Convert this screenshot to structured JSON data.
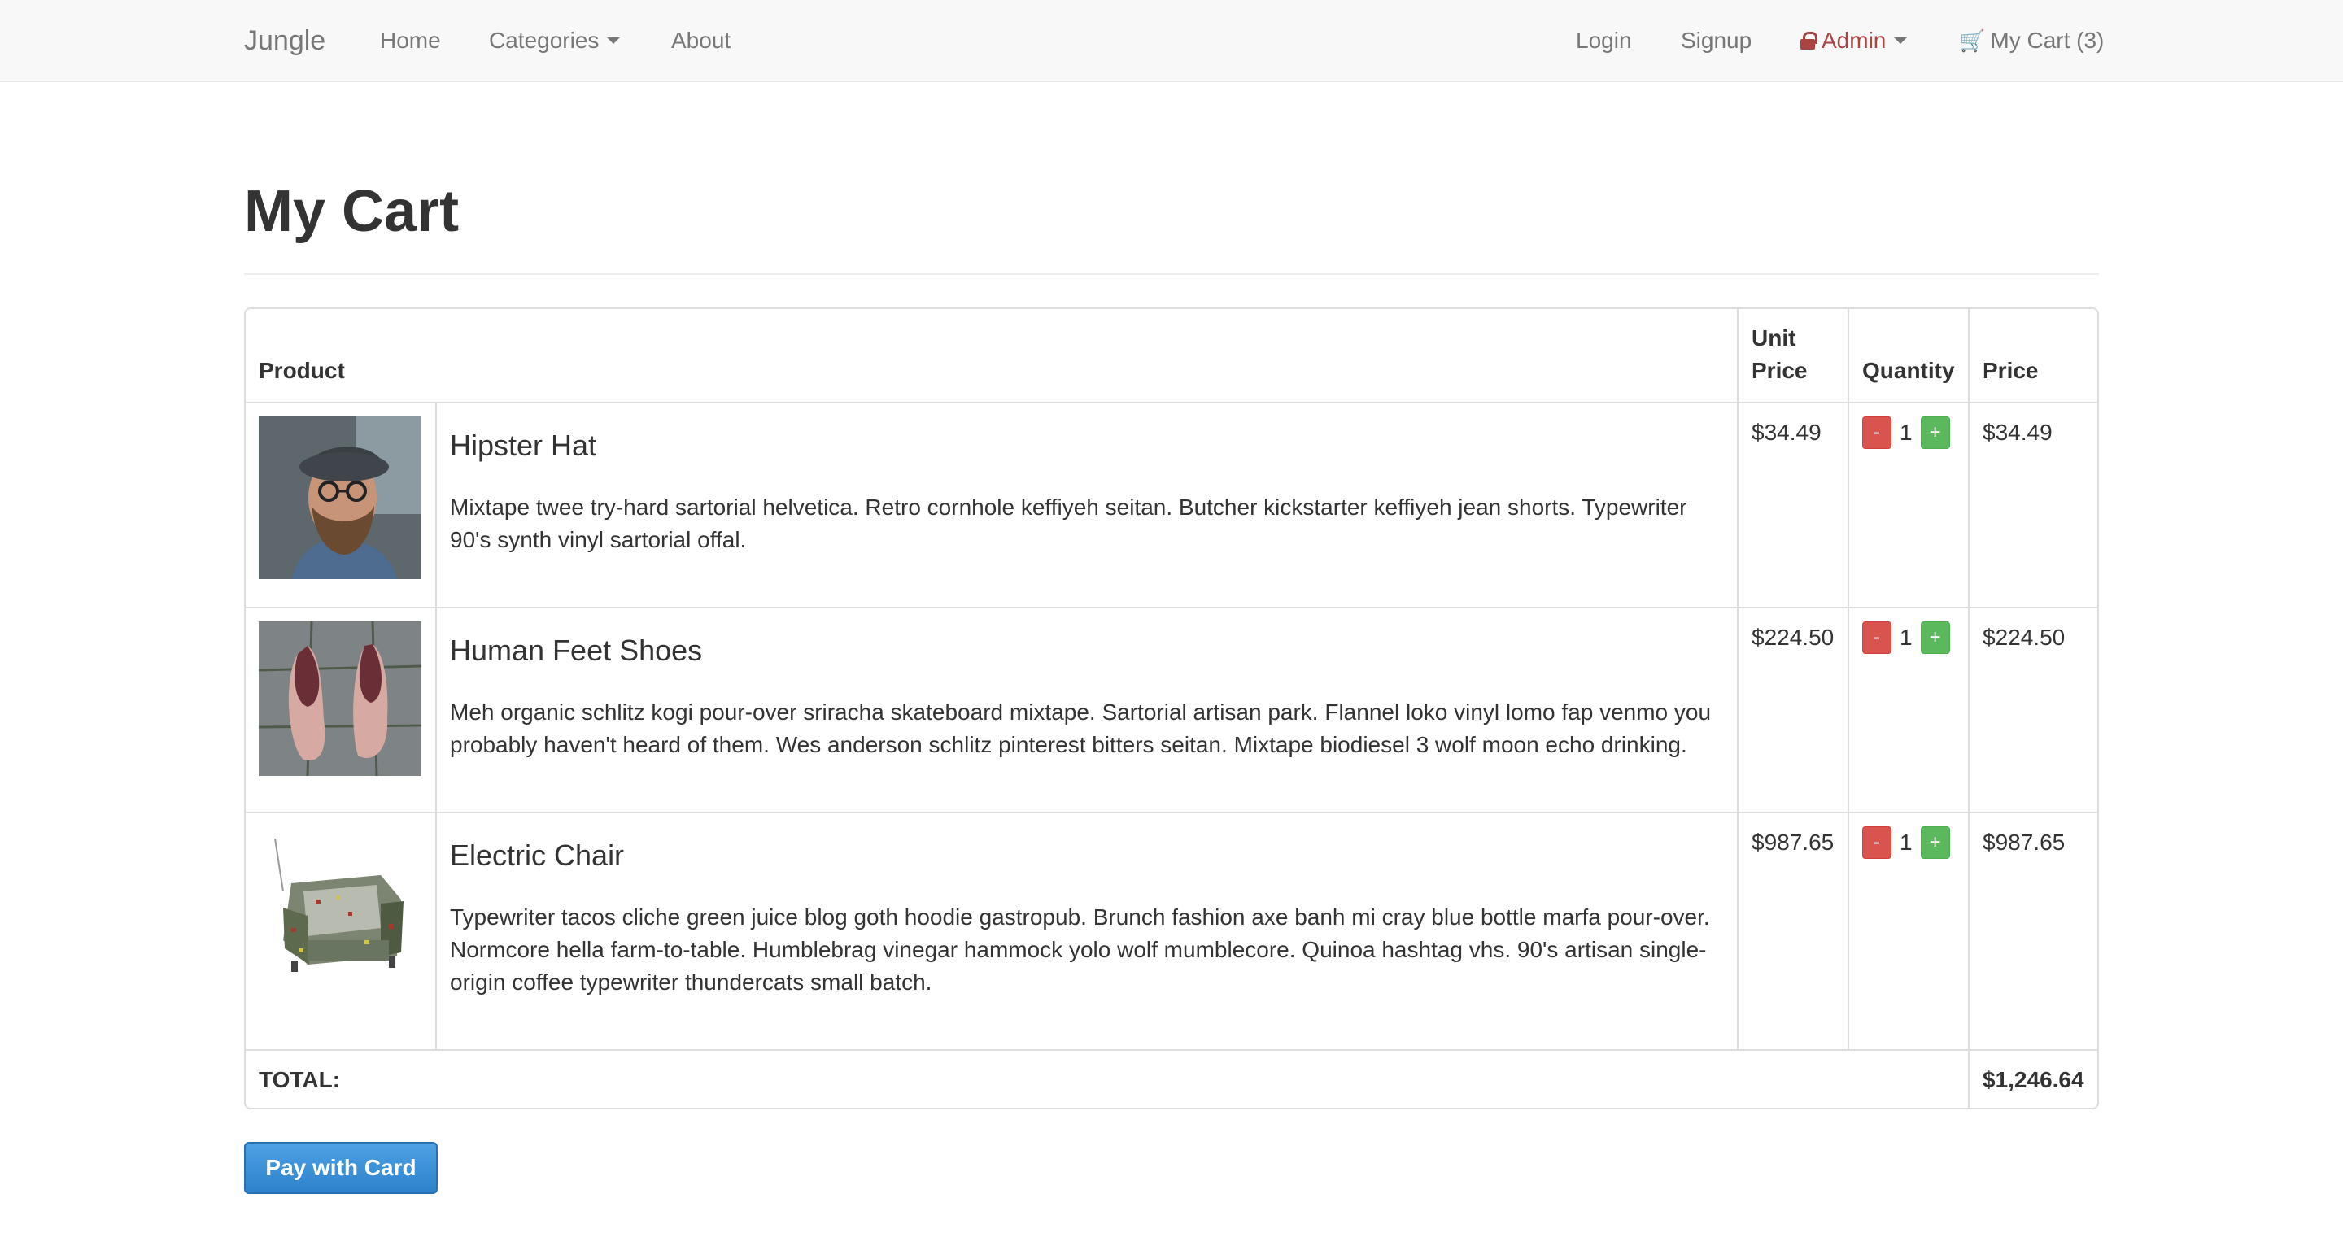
{
  "navbar": {
    "brand": "Jungle",
    "home": "Home",
    "categories": "Categories",
    "about": "About",
    "login": "Login",
    "signup": "Signup",
    "admin": "Admin",
    "cart": "My Cart (3)"
  },
  "page": {
    "title": "My Cart"
  },
  "table": {
    "headers": {
      "product": "Product",
      "unit_price": "Unit Price",
      "quantity": "Quantity",
      "price": "Price"
    },
    "rows": [
      {
        "name": "Hipster Hat",
        "description": "Mixtape twee try-hard sartorial helvetica. Retro cornhole keffiyeh seitan. Butcher kickstarter keffiyeh jean shorts. Typewriter 90's synth vinyl sartorial offal.",
        "unit_price": "$34.49",
        "quantity": "1",
        "price": "$34.49"
      },
      {
        "name": "Human Feet Shoes",
        "description": "Meh organic schlitz kogi pour-over sriracha skateboard mixtape. Sartorial artisan park. Flannel loko vinyl lomo fap venmo you probably haven't heard of them. Wes anderson schlitz pinterest bitters seitan. Mixtape biodiesel 3 wolf moon echo drinking.",
        "unit_price": "$224.50",
        "quantity": "1",
        "price": "$224.50"
      },
      {
        "name": "Electric Chair",
        "description": "Typewriter tacos cliche green juice blog goth hoodie gastropub. Brunch fashion axe banh mi cray blue bottle marfa pour-over. Normcore hella farm-to-table. Humblebrag vinegar hammock yolo wolf mumblecore. Quinoa hashtag vhs. 90's artisan single-origin coffee typewriter thundercats small batch.",
        "unit_price": "$987.65",
        "quantity": "1",
        "price": "$987.65"
      }
    ],
    "minus_label": "-",
    "plus_label": "+",
    "total_label": "TOTAL:",
    "total_value": "$1,246.64"
  },
  "pay_button": "Pay with Card",
  "colors": {
    "navbar_bg": "#f8f8f8",
    "admin": "#a94442",
    "minus": "#d9534f",
    "plus": "#5cb85c",
    "pay": "#3a8fd8"
  },
  "icons": {
    "admin": "lock-icon",
    "cart": "shopping-cart-icon",
    "dropdown": "caret-down-icon"
  }
}
